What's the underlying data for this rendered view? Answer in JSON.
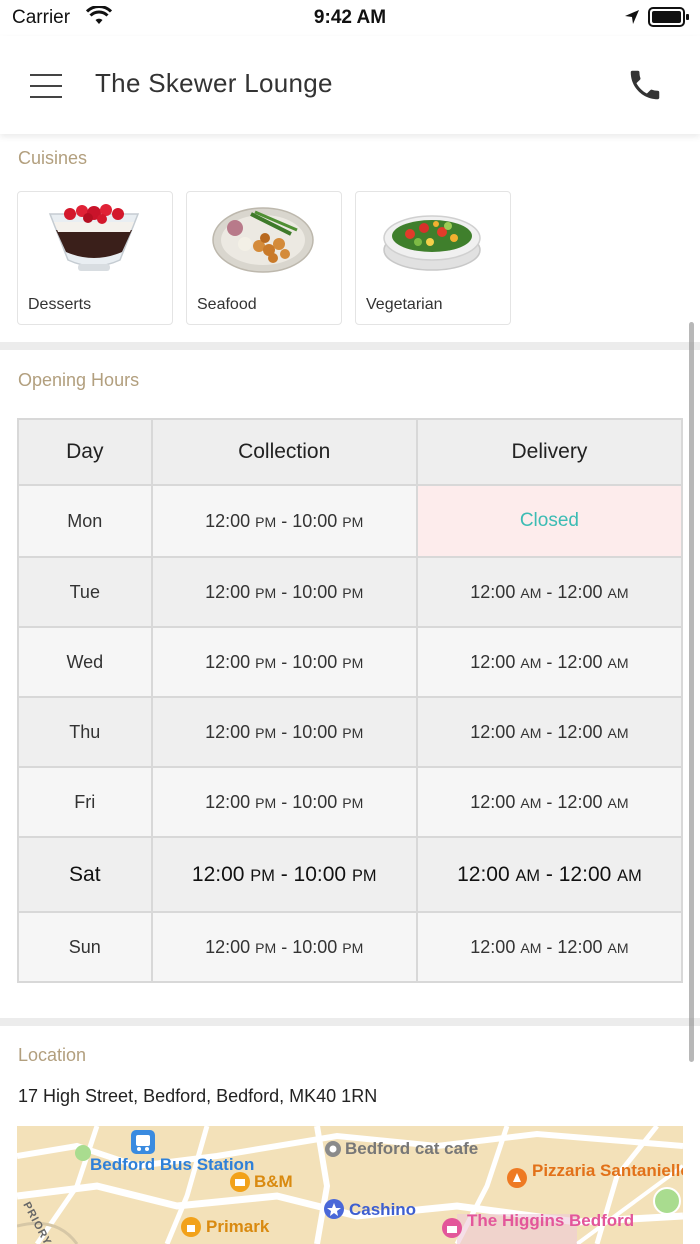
{
  "status_bar": {
    "carrier": "Carrier",
    "time": "9:42 AM"
  },
  "header": {
    "title": "The Skewer Lounge",
    "menu_icon": "hamburger-menu-icon",
    "call_icon": "phone-icon"
  },
  "cuisines": {
    "label": "Cuisines",
    "items": [
      {
        "name": "Desserts",
        "icon": "dessert-bowl-image"
      },
      {
        "name": "Seafood",
        "icon": "seafood-plate-image"
      },
      {
        "name": "Vegetarian",
        "icon": "salad-bowl-image"
      }
    ]
  },
  "opening_hours": {
    "label": "Opening Hours",
    "columns": [
      "Day",
      "Collection",
      "Delivery"
    ],
    "rows": [
      {
        "day": "Mon",
        "collection": {
          "open": "12:00",
          "open_ampm": "PM",
          "close": "10:00",
          "close_ampm": "PM"
        },
        "delivery_closed": "Closed"
      },
      {
        "day": "Tue",
        "collection": {
          "open": "12:00",
          "open_ampm": "PM",
          "close": "10:00",
          "close_ampm": "PM"
        },
        "delivery": {
          "open": "12:00",
          "open_ampm": "AM",
          "close": "12:00",
          "close_ampm": "AM"
        }
      },
      {
        "day": "Wed",
        "collection": {
          "open": "12:00",
          "open_ampm": "PM",
          "close": "10:00",
          "close_ampm": "PM"
        },
        "delivery": {
          "open": "12:00",
          "open_ampm": "AM",
          "close": "12:00",
          "close_ampm": "AM"
        }
      },
      {
        "day": "Thu",
        "collection": {
          "open": "12:00",
          "open_ampm": "PM",
          "close": "10:00",
          "close_ampm": "PM"
        },
        "delivery": {
          "open": "12:00",
          "open_ampm": "AM",
          "close": "12:00",
          "close_ampm": "AM"
        }
      },
      {
        "day": "Fri",
        "collection": {
          "open": "12:00",
          "open_ampm": "PM",
          "close": "10:00",
          "close_ampm": "PM"
        },
        "delivery": {
          "open": "12:00",
          "open_ampm": "AM",
          "close": "12:00",
          "close_ampm": "AM"
        }
      },
      {
        "day": "Sat",
        "collection": {
          "open": "12:00",
          "open_ampm": "PM",
          "close": "10:00",
          "close_ampm": "PM"
        },
        "delivery": {
          "open": "12:00",
          "open_ampm": "AM",
          "close": "12:00",
          "close_ampm": "AM"
        }
      },
      {
        "day": "Sun",
        "collection": {
          "open": "12:00",
          "open_ampm": "PM",
          "close": "10:00",
          "close_ampm": "PM"
        },
        "delivery": {
          "open": "12:00",
          "open_ampm": "AM",
          "close": "12:00",
          "close_ampm": "AM"
        }
      }
    ],
    "separator": "-",
    "closed_color": "#3cbcb4"
  },
  "location": {
    "label": "Location",
    "address": "17 High Street, Bedford, Bedford, MK40 1RN",
    "map_labels": {
      "bus_station": "Bedford Bus Station",
      "bm": "B&M",
      "cat_cafe": "Bedford cat cafe",
      "pizzaria": "Pizzaria Santaniello's",
      "cashino": "Cashino",
      "primark": "Primark",
      "higgins": "The Higgins Bedford",
      "priory": "PRIORY ST"
    }
  },
  "colors": {
    "accent_label": "#b29f7e",
    "closed_text": "#3cbcb4",
    "closed_bg": "#fdecec"
  }
}
